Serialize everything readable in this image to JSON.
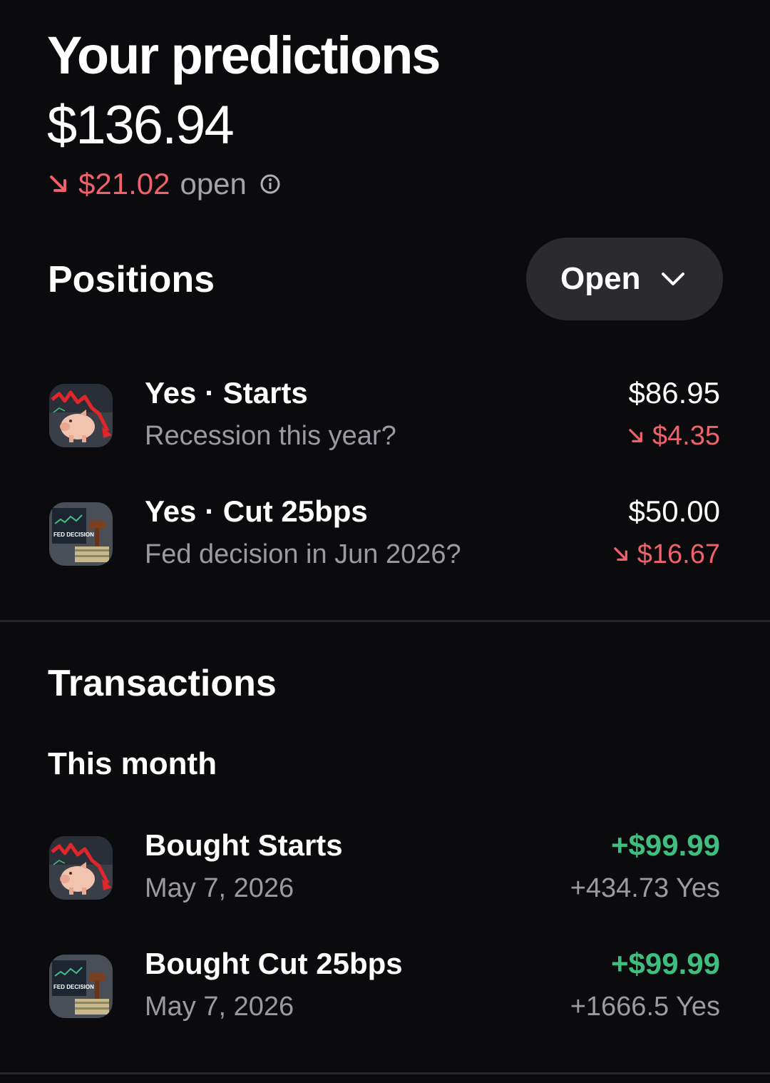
{
  "header": {
    "title": "Your predictions",
    "balance": "$136.94",
    "open_change": "$21.02",
    "open_label": "open"
  },
  "positions": {
    "title": "Positions",
    "filter_label": "Open",
    "items": [
      {
        "title": "Yes · Starts",
        "market": "Recession this year?",
        "value": "$86.95",
        "change": "$4.35",
        "thumbnail": "recession-piggy-bank"
      },
      {
        "title": "Yes · Cut 25bps",
        "market": "Fed decision in Jun 2026?",
        "value": "$50.00",
        "change": "$16.67",
        "thumbnail": "fed-decision-gavel",
        "thumbnail_text": "FED DECISION"
      }
    ]
  },
  "transactions": {
    "title": "Transactions",
    "period": "This month",
    "items": [
      {
        "title": "Bought Starts",
        "date": "May 7, 2026",
        "amount": "+$99.99",
        "shares": "+434.73 Yes",
        "thumbnail": "recession-piggy-bank"
      },
      {
        "title": "Bought Cut 25bps",
        "date": "May 7, 2026",
        "amount": "+$99.99",
        "shares": "+1666.5 Yes",
        "thumbnail": "fed-decision-gavel",
        "thumbnail_text": "FED DECISION"
      }
    ]
  },
  "colors": {
    "background": "#0b0b0d",
    "negative": "#f0616b",
    "positive": "#3fbf7f",
    "muted_text": "#9a9aa2",
    "button_bg": "#2b2b2f"
  }
}
